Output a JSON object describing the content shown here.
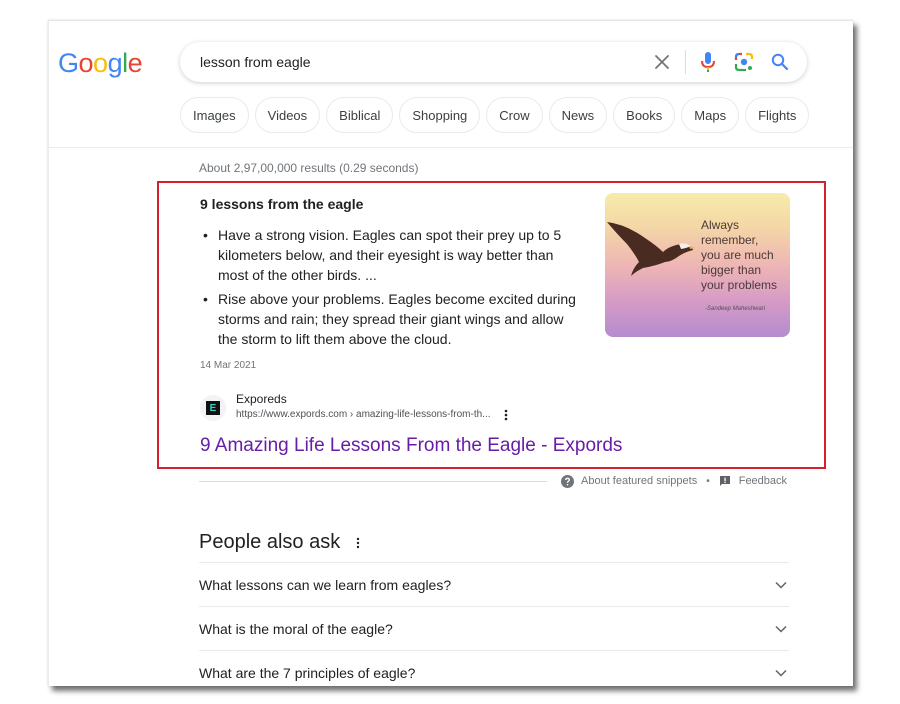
{
  "logo": {
    "text": "Google",
    "letters": [
      "G",
      "o",
      "o",
      "g",
      "l",
      "e"
    ],
    "colors": [
      "#4285F4",
      "#EA4335",
      "#FBBC05",
      "#4285F4",
      "#34A853",
      "#EA4335"
    ]
  },
  "search": {
    "query": "lesson from eagle",
    "clear_icon": "close-icon",
    "mic_icon": "microphone-icon",
    "lens_icon": "google-lens-icon",
    "search_icon": "search-icon"
  },
  "chips": [
    "Images",
    "Videos",
    "Biblical",
    "Shopping",
    "Crow",
    "News",
    "Books",
    "Maps",
    "Flights"
  ],
  "result_stats": "About 2,97,00,000 results (0.29 seconds)",
  "featured_snippet": {
    "highlight_color": "#d3212d",
    "title": "9 lessons from the eagle",
    "bullets": [
      "Have a strong vision. Eagles can spot their prey up to 5 kilometers below, and their eyesight is way better than most of the other birds. ...",
      "Rise above your problems. Eagles become excited during storms and rain; they spread their giant wings and allow the storm to lift them above the cloud."
    ],
    "date": "14 Mar 2021",
    "image": {
      "quote_lines": [
        "Always",
        "remember,",
        "you are much",
        "bigger than",
        "your problems"
      ],
      "author": "-Sandeep Maheshwari"
    },
    "source": {
      "favicon_letter": "E",
      "name": "Exporeds",
      "url": "https://www.expords.com › amazing-life-lessons-from-th..."
    },
    "link_title": "9 Amazing Life Lessons From the Eagle - Expords",
    "link_color": "#681da8"
  },
  "snippet_footer": {
    "about": "About featured snippets",
    "separator": "•",
    "feedback": "Feedback"
  },
  "people_also_ask": {
    "title": "People also ask",
    "questions": [
      "What lessons can we learn from eagles?",
      "What is the moral of the eagle?",
      "What are the 7 principles of eagle?"
    ]
  }
}
